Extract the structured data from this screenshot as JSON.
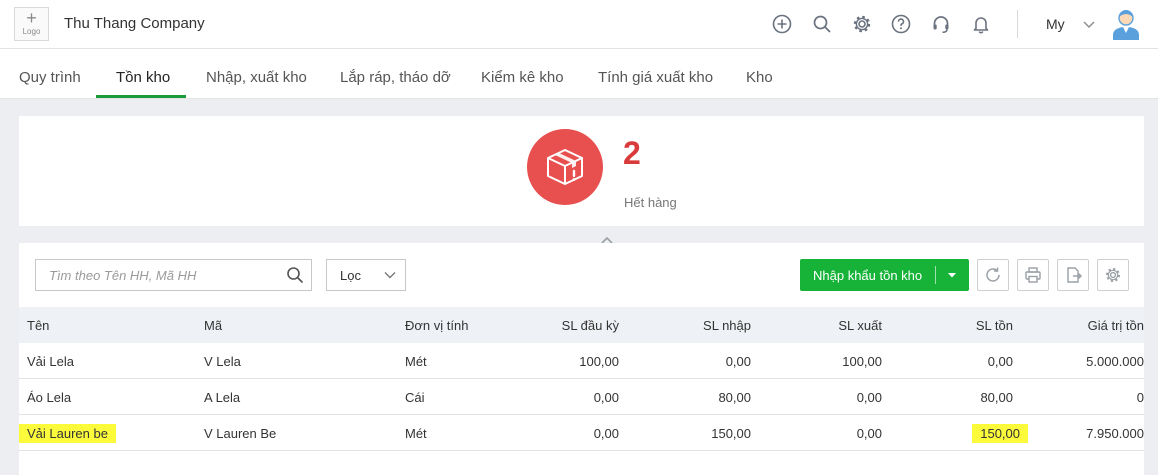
{
  "header": {
    "logo_text": "Logo",
    "company": "Thu Thang Company",
    "user_name": "My",
    "icons": [
      "add-circle-icon",
      "search-icon",
      "gear-icon",
      "help-icon",
      "headset-icon",
      "bell-icon"
    ]
  },
  "tabs": [
    {
      "label": "Quy trình"
    },
    {
      "label": "Tồn kho",
      "active": true
    },
    {
      "label": "Nhập, xuất kho"
    },
    {
      "label": "Lắp ráp, tháo dỡ"
    },
    {
      "label": "Kiểm kê kho"
    },
    {
      "label": "Tính giá xuất kho"
    },
    {
      "label": "Kho"
    }
  ],
  "summary": {
    "count": "2",
    "label": "Hết hàng"
  },
  "toolbar": {
    "search_placeholder": "Tìm theo Tên HH, Mã HH",
    "filter_label": "Lọc",
    "import_label": "Nhập khẩu tồn kho"
  },
  "table": {
    "headers": {
      "name": "Tên",
      "code": "Mã",
      "unit": "Đơn vị tính",
      "opening": "SL đầu kỳ",
      "in": "SL nhập",
      "out": "SL xuất",
      "stock": "SL tồn",
      "value": "Giá trị tồn"
    },
    "rows": [
      {
        "name": "Vải Lela",
        "code": "V Lela",
        "unit": "Mét",
        "opening": "100,00",
        "in": "0,00",
        "out": "100,00",
        "stock": "0,00",
        "value": "5.000.000"
      },
      {
        "name": "Áo Lela",
        "code": "A Lela",
        "unit": "Cái",
        "opening": "0,00",
        "in": "80,00",
        "out": "0,00",
        "stock": "80,00",
        "value": "0"
      },
      {
        "name": "Vải Lauren be",
        "code": "V Lauren Be",
        "unit": "Mét",
        "opening": "0,00",
        "in": "150,00",
        "out": "0,00",
        "stock": "150,00",
        "value": "7.950.000",
        "highlighted": true
      }
    ]
  },
  "colors": {
    "accent": "#16b338",
    "tab_underline": "#1a9b3a",
    "alert": "#e85050",
    "count": "#d93a3a",
    "highlight": "#fbfb3c"
  }
}
